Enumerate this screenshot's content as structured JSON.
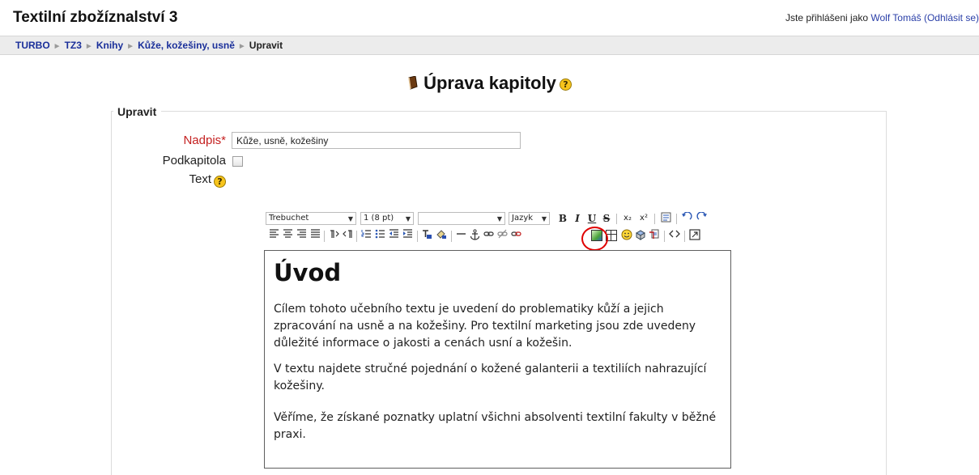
{
  "header": {
    "site_title": "Textilní zbožíznalství 3",
    "login_prefix": "Jste přihlášeni jako ",
    "user_name": "Wolf Tomáš",
    "logout": "(Odhlásit se)"
  },
  "breadcrumb": [
    "TURBO",
    "TZ3",
    "Knihy",
    "Kůže, kožešiny, usně",
    "Upravit"
  ],
  "page": {
    "heading": "Úprava kapitoly",
    "legend": "Upravit"
  },
  "form": {
    "nadpis_label": "Nadpis",
    "required_mark": "*",
    "nadpis_value": "Kůže, usně, kožešiny",
    "podkapitola_label": "Podkapitola",
    "text_label": "Text"
  },
  "toolbar": {
    "font": "Trebuchet",
    "size": "1 (8 pt)",
    "style": "",
    "language": "Jazyk",
    "bold": "B",
    "italic": "I",
    "underline": "U",
    "strike": "S",
    "subscript": "x₂",
    "superscript": "x²",
    "icons": [
      "align-left-icon",
      "align-center-icon",
      "align-right-icon",
      "justify-icon",
      "ltr-icon",
      "rtl-icon",
      "ordered-list-icon",
      "unordered-list-icon",
      "outdent-icon",
      "indent-icon",
      "text-color-icon",
      "background-color-icon",
      "horizontal-rule-icon",
      "anchor-icon",
      "link-icon",
      "unlink-icon",
      "nolink-icon",
      "insert-image-icon",
      "insert-table-icon",
      "smiley-icon",
      "special-char-icon",
      "search-replace-icon",
      "html-source-icon",
      "fullscreen-icon"
    ]
  },
  "editor": {
    "heading": "Úvod",
    "paragraphs": [
      "Cílem tohoto učebního textu je uvedení do problematiky kůží a jejich zpracování na usně a na kožešiny. Pro textilní marketing jsou zde uvedeny důležité informace o jakosti a cenách usní a kožešin.",
      "V textu najdete stručné pojednání o kožené galanterii a textiliích nahrazující kožešiny.",
      "Věříme, že získané poznatky uplatní všichni absolventi textilní fakulty v běžné praxi."
    ]
  },
  "colors": {
    "link": "#1a2f9a",
    "required": "#c42020",
    "highlight": "#e00000"
  }
}
